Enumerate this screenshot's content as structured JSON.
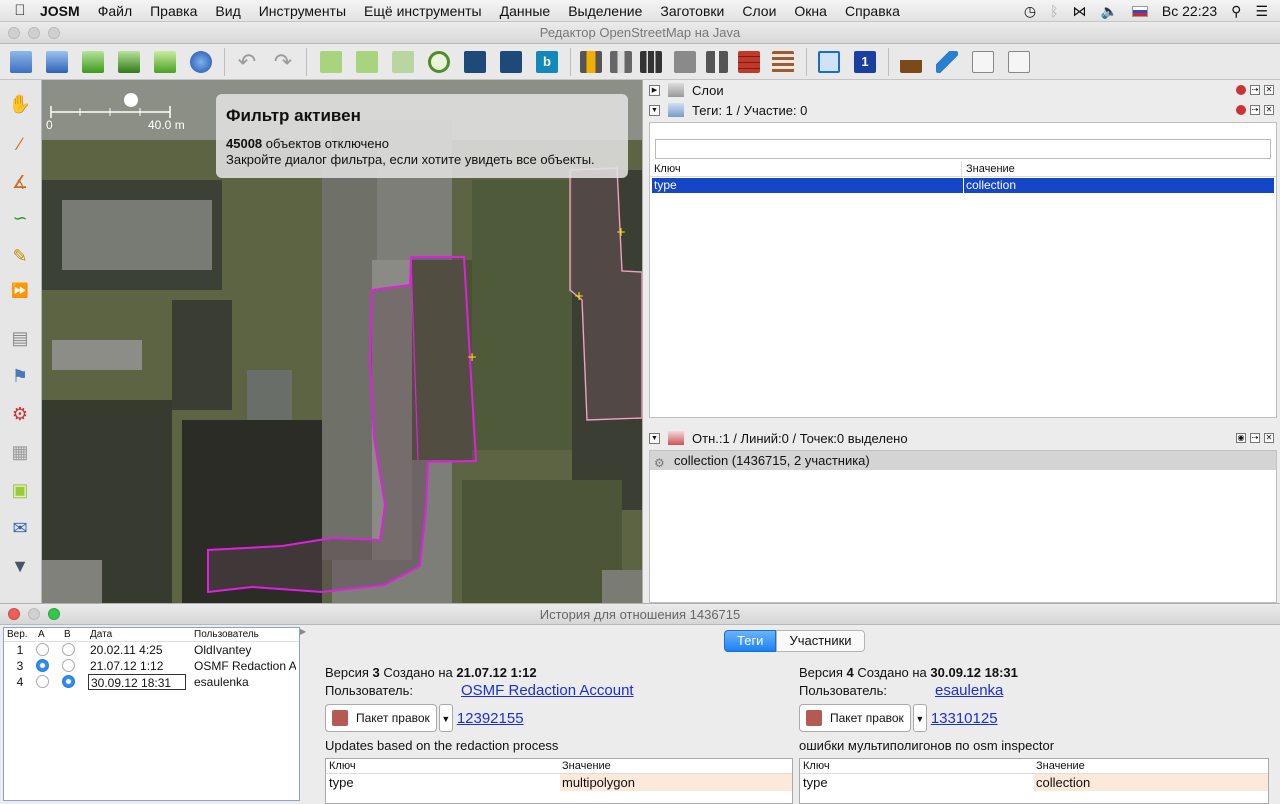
{
  "menubar": {
    "apple": "",
    "app": "JOSM",
    "items": [
      "Файл",
      "Правка",
      "Вид",
      "Инструменты",
      "Ещё инструменты",
      "Данные",
      "Выделение",
      "Заготовки",
      "Слои",
      "Окна",
      "Справка"
    ],
    "clock": "Вс 22:23"
  },
  "window_title": "Редактор OpenStreetMap на Java",
  "map": {
    "scale_start": "0",
    "scale_end": "40.0 m",
    "filter_title": "Фильтр активен",
    "filter_count": "45008",
    "filter_line1_rest": " объектов отключено",
    "filter_line2": "Закройте диалог фильтра, если хотите увидеть все объекты."
  },
  "panels": {
    "layers_title": "Слои",
    "tags_title": "Теги: 1 / Участие: 0",
    "col_key": "Ключ",
    "col_value": "Значение",
    "tag_key": "type",
    "tag_value": "collection",
    "selection_title": "Отн.:1 / Линий:0 / Точек:0 выделено",
    "selection_item": "collection (1436715, 2 участника)"
  },
  "history": {
    "title": "История для отношения 1436715",
    "columns": [
      "Вер.",
      "A",
      "B",
      "Дата",
      "Пользователь"
    ],
    "rows": [
      {
        "ver": "1",
        "date": "20.02.11 4:25",
        "user": "OldIvantey",
        "a": false,
        "b": false
      },
      {
        "ver": "3",
        "date": "21.07.12 1:12",
        "user": "OSMF Redaction A",
        "a": true,
        "b": false
      },
      {
        "ver": "4",
        "date": "30.09.12 18:31",
        "user": "esaulenka",
        "a": false,
        "b": true
      }
    ],
    "tab_tags": "Теги",
    "tab_members": "Участники",
    "left": {
      "version_prefix": "Версия ",
      "version": "3",
      "created_on": " Создано на ",
      "date": "21.07.12 1:12",
      "user_label": "Пользователь:",
      "user": "OSMF Redaction Account",
      "changeset_btn": "Пакет правок",
      "changeset": "12392155",
      "comment": "Updates based on the redaction process",
      "key_col": "Ключ",
      "value_col": "Значение",
      "key": "type",
      "value": "multipolygon"
    },
    "right": {
      "version_prefix": "Версия ",
      "version": "4",
      "created_on": " Создано на ",
      "date": "30.09.12 18:31",
      "user_label": "Пользователь:",
      "user": "esaulenka",
      "changeset_btn": "Пакет правок",
      "changeset": "13310125",
      "comment": "ошибки мультиполигонов по osm inspector",
      "key_col": "Ключ",
      "value_col": "Значение",
      "key": "type",
      "value": "collection"
    }
  },
  "colors": {
    "selection": "#1446c7",
    "relation": "#e020e0",
    "changed_value": "#fde9d9"
  }
}
